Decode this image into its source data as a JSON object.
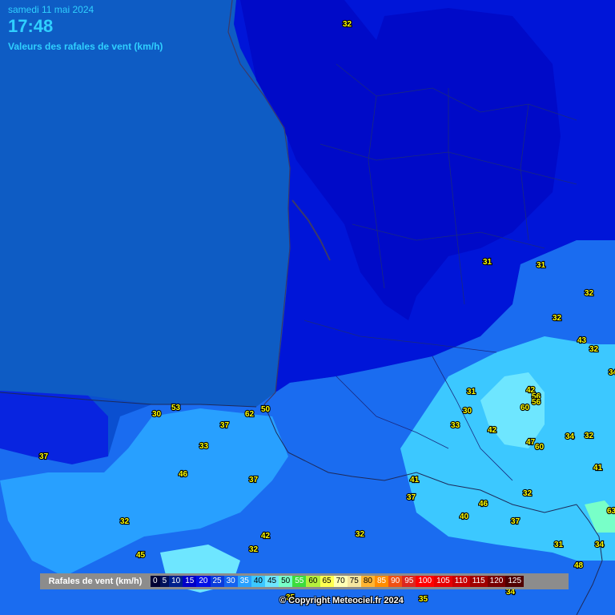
{
  "header": {
    "date": "samedi 11 mai 2024",
    "time": "17:48",
    "subtitle": "Valeurs des rafales de vent (km/h)"
  },
  "legend": {
    "title": "Rafales de vent (km/h)",
    "steps": [
      {
        "value": "0",
        "color": "#000033"
      },
      {
        "value": "5",
        "color": "#00105a"
      },
      {
        "value": "10",
        "color": "#00208c"
      },
      {
        "value": "15",
        "color": "#0000c8"
      },
      {
        "value": "20",
        "color": "#0010e6"
      },
      {
        "value": "25",
        "color": "#0a3cdc"
      },
      {
        "value": "30",
        "color": "#1464f0"
      },
      {
        "value": "35",
        "color": "#28a0ff"
      },
      {
        "value": "40",
        "color": "#3cc8ff"
      },
      {
        "value": "45",
        "color": "#6ee6ff"
      },
      {
        "value": "50",
        "color": "#78ffc8"
      },
      {
        "value": "55",
        "color": "#3cdc3c"
      },
      {
        "value": "60",
        "color": "#b4f03c"
      },
      {
        "value": "65",
        "color": "#ffff50"
      },
      {
        "value": "70",
        "color": "#ffffb4"
      },
      {
        "value": "75",
        "color": "#f5e6a0"
      },
      {
        "value": "80",
        "color": "#ffb432"
      },
      {
        "value": "85",
        "color": "#ff8c00"
      },
      {
        "value": "90",
        "color": "#f05014"
      },
      {
        "value": "95",
        "color": "#dc281e"
      },
      {
        "value": "100",
        "color": "#ff0000"
      },
      {
        "value": "105",
        "color": "#e60000"
      },
      {
        "value": "110",
        "color": "#c80000"
      },
      {
        "value": "115",
        "color": "#a00000"
      },
      {
        "value": "120",
        "color": "#780000"
      },
      {
        "value": "125",
        "color": "#500000"
      }
    ]
  },
  "copyright": "© Copyright Meteociel.fr 2024",
  "gust_values": [
    "32",
    "31",
    "31",
    "32",
    "32",
    "43",
    "32",
    "34",
    "42",
    "31",
    "30",
    "56",
    "56",
    "60",
    "33",
    "42",
    "47",
    "60",
    "34",
    "32",
    "41",
    "41",
    "37",
    "32",
    "46",
    "40",
    "37",
    "63",
    "31",
    "34",
    "48",
    "34",
    "53",
    "30",
    "37",
    "62",
    "50",
    "33",
    "37",
    "46",
    "37",
    "32",
    "42",
    "32",
    "32",
    "45",
    "35",
    "35"
  ]
}
